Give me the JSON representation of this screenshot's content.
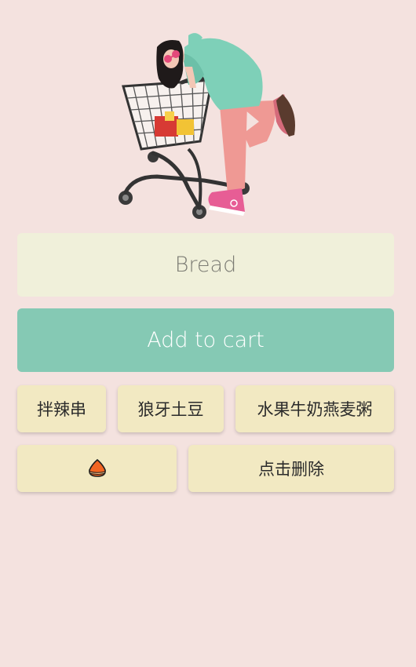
{
  "hero": {
    "illustration": "girl-pushing-shopping-cart-illustration"
  },
  "input": {
    "placeholder": "Bread",
    "value": ""
  },
  "actions": {
    "add_label": "Add to cart"
  },
  "items": [
    {
      "label": "拌辣串"
    },
    {
      "label": "狼牙土豆"
    },
    {
      "label": "水果牛奶燕麦粥"
    },
    {
      "label": "",
      "icon": "chestnut-icon"
    },
    {
      "label": "点击删除"
    }
  ],
  "colors": {
    "background": "#f4e2df",
    "input_bg": "#f0f0da",
    "accent": "#85c9b4",
    "chip_bg": "#f2e9c2",
    "chestnut": "#f26522"
  }
}
